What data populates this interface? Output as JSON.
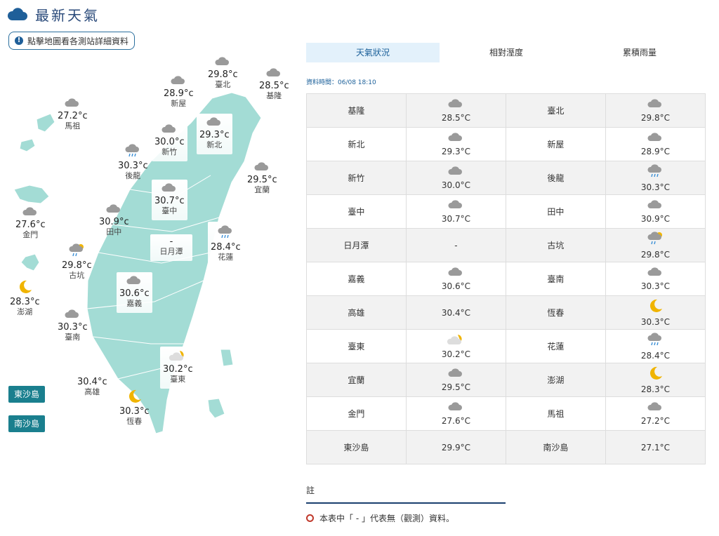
{
  "header": {
    "title": "最新天氣",
    "icon": "cloud-icon"
  },
  "hint_button": "點擊地圖看各測站詳細資料",
  "tabs": [
    {
      "label": "天氣狀況",
      "active": true
    },
    {
      "label": "相對溼度",
      "active": false
    },
    {
      "label": "累積雨量",
      "active": false
    }
  ],
  "data_time": "資料時間：06/08 18:10",
  "island_buttons": [
    "東沙島",
    "南沙島"
  ],
  "map_cities": [
    {
      "id": "taipei",
      "name": "臺北",
      "temp": "29.8°c",
      "icon": "cloudy"
    },
    {
      "id": "keelung",
      "name": "基隆",
      "temp": "28.5°c",
      "icon": "cloudy"
    },
    {
      "id": "xinwu",
      "name": "新屋",
      "temp": "28.9°c",
      "icon": "cloudy"
    },
    {
      "id": "matsu",
      "name": "馬祖",
      "temp": "27.2°c",
      "icon": "cloudy"
    },
    {
      "id": "hsinchu",
      "name": "新竹",
      "temp": "30.0°c",
      "icon": "cloudy"
    },
    {
      "id": "newtaipei",
      "name": "新北",
      "temp": "29.3°c",
      "icon": "cloudy"
    },
    {
      "id": "houlong",
      "name": "後龍",
      "temp": "30.3°c",
      "icon": "rain"
    },
    {
      "id": "yilan",
      "name": "宜蘭",
      "temp": "29.5°c",
      "icon": "cloudy"
    },
    {
      "id": "taichung",
      "name": "臺中",
      "temp": "30.7°c",
      "icon": "cloudy"
    },
    {
      "id": "kinmen",
      "name": "金門",
      "temp": "27.6°c",
      "icon": "cloudy"
    },
    {
      "id": "tianzhong",
      "name": "田中",
      "temp": "30.9°c",
      "icon": "cloudy"
    },
    {
      "id": "sunmoon",
      "name": "日月潭",
      "temp": "-",
      "icon": "none"
    },
    {
      "id": "hualien",
      "name": "花蓮",
      "temp": "28.4°c",
      "icon": "rain"
    },
    {
      "id": "gukeng",
      "name": "古坑",
      "temp": "29.8°c",
      "icon": "rain-sun"
    },
    {
      "id": "penghu",
      "name": "澎湖",
      "temp": "28.3°c",
      "icon": "moon"
    },
    {
      "id": "chiayi",
      "name": "嘉義",
      "temp": "30.6°c",
      "icon": "cloudy"
    },
    {
      "id": "tainan",
      "name": "臺南",
      "temp": "30.3°c",
      "icon": "cloudy"
    },
    {
      "id": "taitung",
      "name": "臺東",
      "temp": "30.2°c",
      "icon": "partly"
    },
    {
      "id": "kaohsiung",
      "name": "高雄",
      "temp": "30.4°c",
      "icon": "none"
    },
    {
      "id": "hengchun",
      "name": "恆春",
      "temp": "30.3°c",
      "icon": "moon"
    }
  ],
  "table_rows": [
    [
      {
        "name": "基隆",
        "temp": "28.5°C",
        "icon": "cloudy"
      },
      {
        "name": "臺北",
        "temp": "29.8°C",
        "icon": "cloudy"
      }
    ],
    [
      {
        "name": "新北",
        "temp": "29.3°C",
        "icon": "cloudy"
      },
      {
        "name": "新屋",
        "temp": "28.9°C",
        "icon": "cloudy"
      }
    ],
    [
      {
        "name": "新竹",
        "temp": "30.0°C",
        "icon": "cloudy"
      },
      {
        "name": "後龍",
        "temp": "30.3°C",
        "icon": "rain"
      }
    ],
    [
      {
        "name": "臺中",
        "temp": "30.7°C",
        "icon": "cloudy"
      },
      {
        "name": "田中",
        "temp": "30.9°C",
        "icon": "cloudy"
      }
    ],
    [
      {
        "name": "日月潭",
        "temp": "-",
        "icon": "none"
      },
      {
        "name": "古坑",
        "temp": "29.8°C",
        "icon": "rain-sun"
      }
    ],
    [
      {
        "name": "嘉義",
        "temp": "30.6°C",
        "icon": "cloudy"
      },
      {
        "name": "臺南",
        "temp": "30.3°C",
        "icon": "cloudy"
      }
    ],
    [
      {
        "name": "高雄",
        "temp": "30.4°C",
        "icon": "none"
      },
      {
        "name": "恆春",
        "temp": "30.3°C",
        "icon": "moon"
      }
    ],
    [
      {
        "name": "臺東",
        "temp": "30.2°C",
        "icon": "partly"
      },
      {
        "name": "花蓮",
        "temp": "28.4°C",
        "icon": "rain"
      }
    ],
    [
      {
        "name": "宜蘭",
        "temp": "29.5°C",
        "icon": "cloudy"
      },
      {
        "name": "澎湖",
        "temp": "28.3°C",
        "icon": "moon"
      }
    ],
    [
      {
        "name": "金門",
        "temp": "27.6°C",
        "icon": "cloudy"
      },
      {
        "name": "馬祖",
        "temp": "27.2°C",
        "icon": "cloudy"
      }
    ],
    [
      {
        "name": "東沙島",
        "temp": "29.9°C",
        "icon": "none"
      },
      {
        "name": "南沙島",
        "temp": "27.1°C",
        "icon": "none"
      }
    ]
  ],
  "note": {
    "title": "註",
    "item": "本表中「 - 」代表無（觀測）資料。"
  },
  "colors": {
    "land": "#a3dcd5",
    "accent": "#1a5f99",
    "island_button": "#1a7f8e",
    "moon": "#f0b400"
  }
}
